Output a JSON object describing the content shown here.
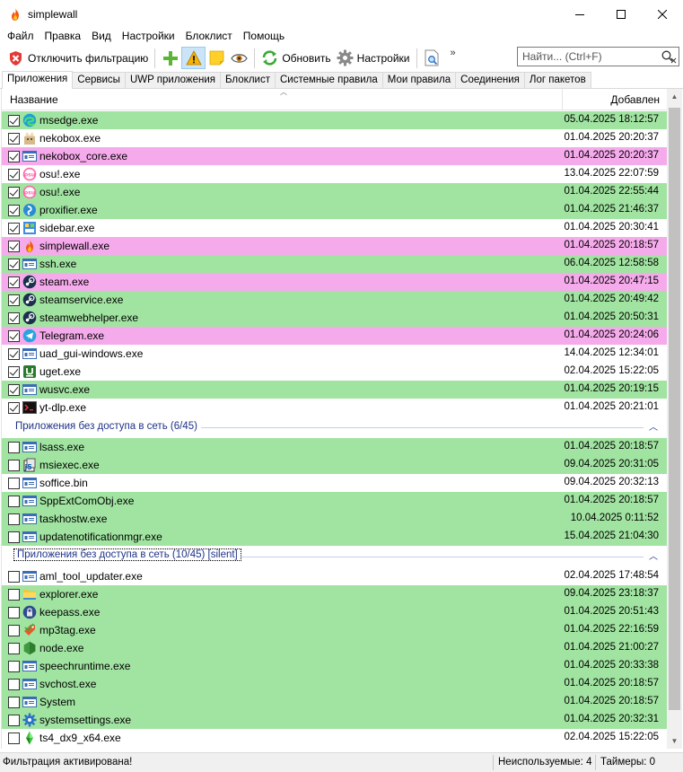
{
  "window": {
    "title": "simplewall"
  },
  "menu": [
    "Файл",
    "Правка",
    "Вид",
    "Настройки",
    "Блоклист",
    "Помощь"
  ],
  "toolbar": {
    "disable_filter_label": "Отключить фильтрацию",
    "refresh_label": "Обновить",
    "settings_label": "Настройки",
    "overflow": "»"
  },
  "search": {
    "placeholder": "Найти... (Ctrl+F)"
  },
  "tabs": [
    "Приложения",
    "Сервисы",
    "UWP приложения",
    "Блоклист",
    "Системные правила",
    "Мои правила",
    "Соединения",
    "Лог пакетов"
  ],
  "columns": {
    "name": "Название",
    "added": "Добавлен"
  },
  "groups": [
    {
      "label": "",
      "rows": [
        {
          "name": "msedge.exe",
          "date": "05.04.2025 18:12:57",
          "checked": true,
          "color": "green",
          "icon": "edge-icon"
        },
        {
          "name": "nekobox.exe",
          "date": "01.04.2025 20:20:37",
          "checked": true,
          "color": "none",
          "icon": "nekobox-icon"
        },
        {
          "name": "nekobox_core.exe",
          "date": "01.04.2025 20:20:37",
          "checked": true,
          "color": "pink",
          "icon": "generic-exe-icon"
        },
        {
          "name": "osu!.exe",
          "date": "13.04.2025 22:07:59",
          "checked": true,
          "color": "none",
          "icon": "osu-icon"
        },
        {
          "name": "osu!.exe",
          "date": "01.04.2025 22:55:44",
          "checked": true,
          "color": "green",
          "icon": "osu-icon"
        },
        {
          "name": "proxifier.exe",
          "date": "01.04.2025 21:46:37",
          "checked": true,
          "color": "green",
          "icon": "proxifier-icon"
        },
        {
          "name": "sidebar.exe",
          "date": "01.04.2025 20:30:41",
          "checked": true,
          "color": "none",
          "icon": "sidebar-icon"
        },
        {
          "name": "simplewall.exe",
          "date": "01.04.2025 20:18:57",
          "checked": true,
          "color": "pink",
          "icon": "flame-icon"
        },
        {
          "name": "ssh.exe",
          "date": "06.04.2025 12:58:58",
          "checked": true,
          "color": "green",
          "icon": "generic-exe-icon"
        },
        {
          "name": "steam.exe",
          "date": "01.04.2025 20:47:15",
          "checked": true,
          "color": "pink",
          "icon": "steam-icon"
        },
        {
          "name": "steamservice.exe",
          "date": "01.04.2025 20:49:42",
          "checked": true,
          "color": "green",
          "icon": "steam-icon"
        },
        {
          "name": "steamwebhelper.exe",
          "date": "01.04.2025 20:50:31",
          "checked": true,
          "color": "green",
          "icon": "steam-icon"
        },
        {
          "name": "Telegram.exe",
          "date": "01.04.2025 20:24:06",
          "checked": true,
          "color": "pink",
          "icon": "telegram-icon"
        },
        {
          "name": "uad_gui-windows.exe",
          "date": "14.04.2025 12:34:01",
          "checked": true,
          "color": "none",
          "icon": "generic-exe-icon"
        },
        {
          "name": "uget.exe",
          "date": "02.04.2025 15:22:05",
          "checked": true,
          "color": "none",
          "icon": "uget-icon"
        },
        {
          "name": "wusvc.exe",
          "date": "01.04.2025 20:19:15",
          "checked": true,
          "color": "green",
          "icon": "generic-exe-icon"
        },
        {
          "name": "yt-dlp.exe",
          "date": "01.04.2025 20:21:01",
          "checked": true,
          "color": "none",
          "icon": "terminal-icon"
        }
      ]
    },
    {
      "label": "Приложения без доступа в сеть (6/45)",
      "rows": [
        {
          "name": "lsass.exe",
          "date": "01.04.2025 20:18:57",
          "checked": false,
          "color": "green",
          "icon": "generic-exe-icon"
        },
        {
          "name": "msiexec.exe",
          "date": "09.04.2025 20:31:05",
          "checked": false,
          "color": "green",
          "icon": "installer-icon"
        },
        {
          "name": "soffice.bin",
          "date": "09.04.2025 20:32:13",
          "checked": false,
          "color": "none",
          "icon": "generic-exe-icon"
        },
        {
          "name": "SppExtComObj.exe",
          "date": "01.04.2025 20:18:57",
          "checked": false,
          "color": "green",
          "icon": "generic-exe-icon"
        },
        {
          "name": "taskhostw.exe",
          "date": "10.04.2025 0:11:52",
          "checked": false,
          "color": "green",
          "icon": "generic-exe-icon"
        },
        {
          "name": "updatenotificationmgr.exe",
          "date": "15.04.2025 21:04:30",
          "checked": false,
          "color": "green",
          "icon": "generic-exe-icon"
        }
      ]
    },
    {
      "label": "Приложения без доступа в сеть (10/45) [silent]",
      "rows": [
        {
          "name": "aml_tool_updater.exe",
          "date": "02.04.2025 17:48:54",
          "checked": false,
          "color": "none",
          "icon": "generic-exe-icon"
        },
        {
          "name": "explorer.exe",
          "date": "09.04.2025 23:18:37",
          "checked": false,
          "color": "green",
          "icon": "explorer-icon"
        },
        {
          "name": "keepass.exe",
          "date": "01.04.2025 20:51:43",
          "checked": false,
          "color": "green",
          "icon": "keepass-icon"
        },
        {
          "name": "mp3tag.exe",
          "date": "01.04.2025 22:16:59",
          "checked": false,
          "color": "green",
          "icon": "mp3tag-icon"
        },
        {
          "name": "node.exe",
          "date": "01.04.2025 21:00:27",
          "checked": false,
          "color": "green",
          "icon": "node-icon"
        },
        {
          "name": "speechruntime.exe",
          "date": "01.04.2025 20:33:38",
          "checked": false,
          "color": "green",
          "icon": "generic-exe-icon"
        },
        {
          "name": "svchost.exe",
          "date": "01.04.2025 20:18:57",
          "checked": false,
          "color": "green",
          "icon": "generic-exe-icon"
        },
        {
          "name": "System",
          "date": "01.04.2025 20:18:57",
          "checked": false,
          "color": "green",
          "icon": "generic-exe-icon"
        },
        {
          "name": "systemsettings.exe",
          "date": "01.04.2025 20:32:31",
          "checked": false,
          "color": "green",
          "icon": "gear-icon"
        },
        {
          "name": "ts4_dx9_x64.exe",
          "date": "02.04.2025 15:22:05",
          "checked": false,
          "color": "none",
          "icon": "plumbob-icon"
        }
      ]
    }
  ],
  "status": {
    "filter": "Фильтрация активирована!",
    "unused": "Неиспользуемые: 4",
    "timers": "Таймеры: 0"
  },
  "colors": {
    "green": "#a1e3a1",
    "pink": "#f5aaeb",
    "group_text": "#1e3287"
  }
}
